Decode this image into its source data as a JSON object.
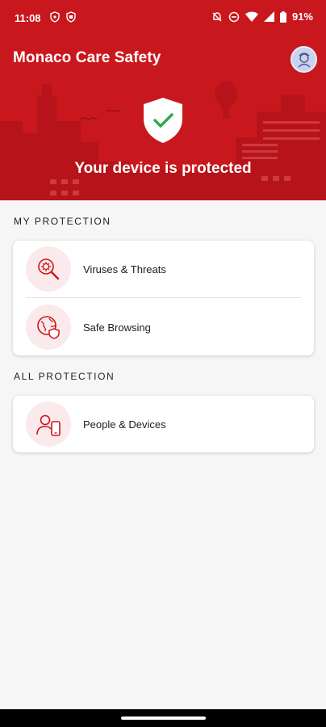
{
  "status_bar": {
    "time": "11:08",
    "battery": "91%",
    "icons_left": [
      "shield-notification-icon",
      "shield-badge-icon"
    ],
    "icons_right": [
      "mute-icon",
      "do-not-disturb-icon",
      "wifi-icon",
      "signal-icon",
      "battery-icon"
    ]
  },
  "header": {
    "title": "Monaco Care Safety",
    "status_text": "Your device is protected",
    "brand_color": "#c8181e"
  },
  "sections": {
    "my_protection": {
      "title": "MY PROTECTION",
      "items": [
        {
          "label": "Viruses & Threats",
          "icon": "virus-magnifier-icon"
        },
        {
          "label": "Safe Browsing",
          "icon": "globe-shield-icon"
        }
      ]
    },
    "all_protection": {
      "title": "ALL PROTECTION",
      "items": [
        {
          "label": "People & Devices",
          "icon": "person-phone-icon"
        }
      ]
    }
  }
}
